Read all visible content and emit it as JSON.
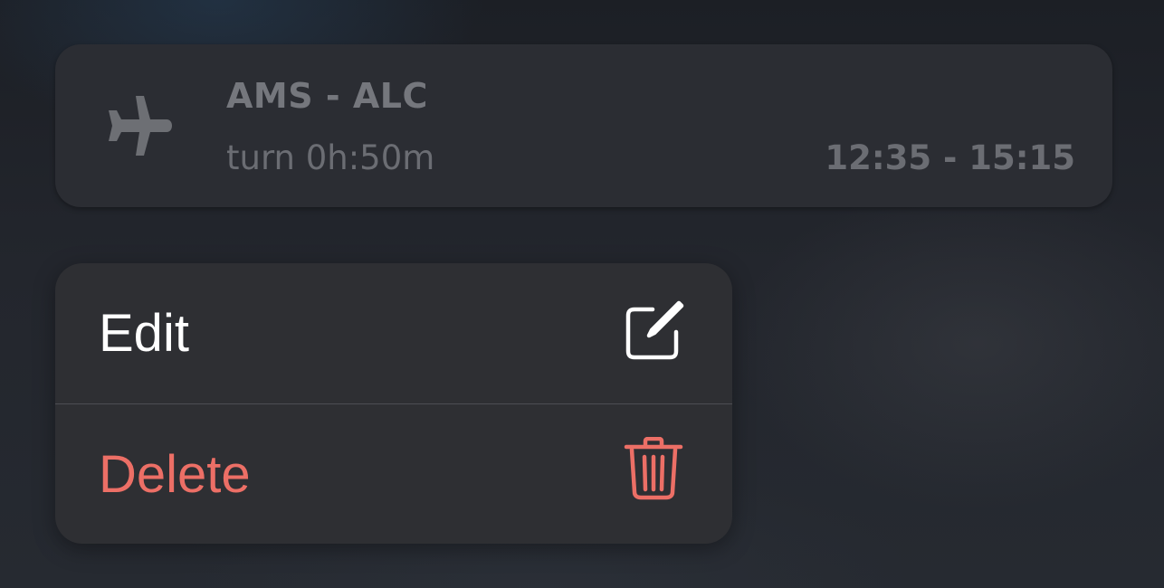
{
  "flight": {
    "route": "AMS - ALC",
    "turn": "turn 0h:50m",
    "times": "12:35 - 15:15",
    "icon": "airplane-icon"
  },
  "menu": {
    "items": [
      {
        "label": "Edit",
        "icon": "edit-icon",
        "color": "#ffffff"
      },
      {
        "label": "Delete",
        "icon": "trash-icon",
        "color": "#ec6f66"
      }
    ]
  }
}
